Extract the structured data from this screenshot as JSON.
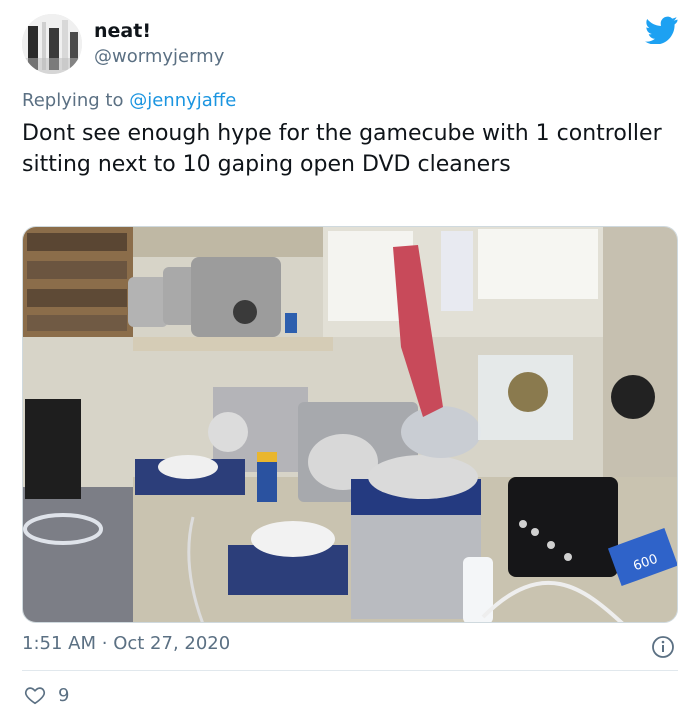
{
  "author": {
    "display_name": "neat!",
    "handle": "@wormyjermy"
  },
  "reply": {
    "prefix": "Replying to",
    "to": "@jennyjaffe"
  },
  "tweet": {
    "text": "Dont see enough hype for the gamecube  with 1 controller sitting next to 10 gaping open DVD cleaners"
  },
  "meta": {
    "time": "1:51 AM",
    "separator": "·",
    "date": "Oct 27, 2020"
  },
  "engagement": {
    "likes": "9"
  },
  "media": {
    "labels": {
      "badge": "600"
    }
  },
  "icons": {
    "brand": "twitter-bird-icon",
    "info": "info-icon",
    "like": "heart-icon"
  },
  "colors": {
    "brand_blue": "#1da1f2",
    "link_blue": "#1b95e0",
    "muted_text": "#5b7083"
  }
}
